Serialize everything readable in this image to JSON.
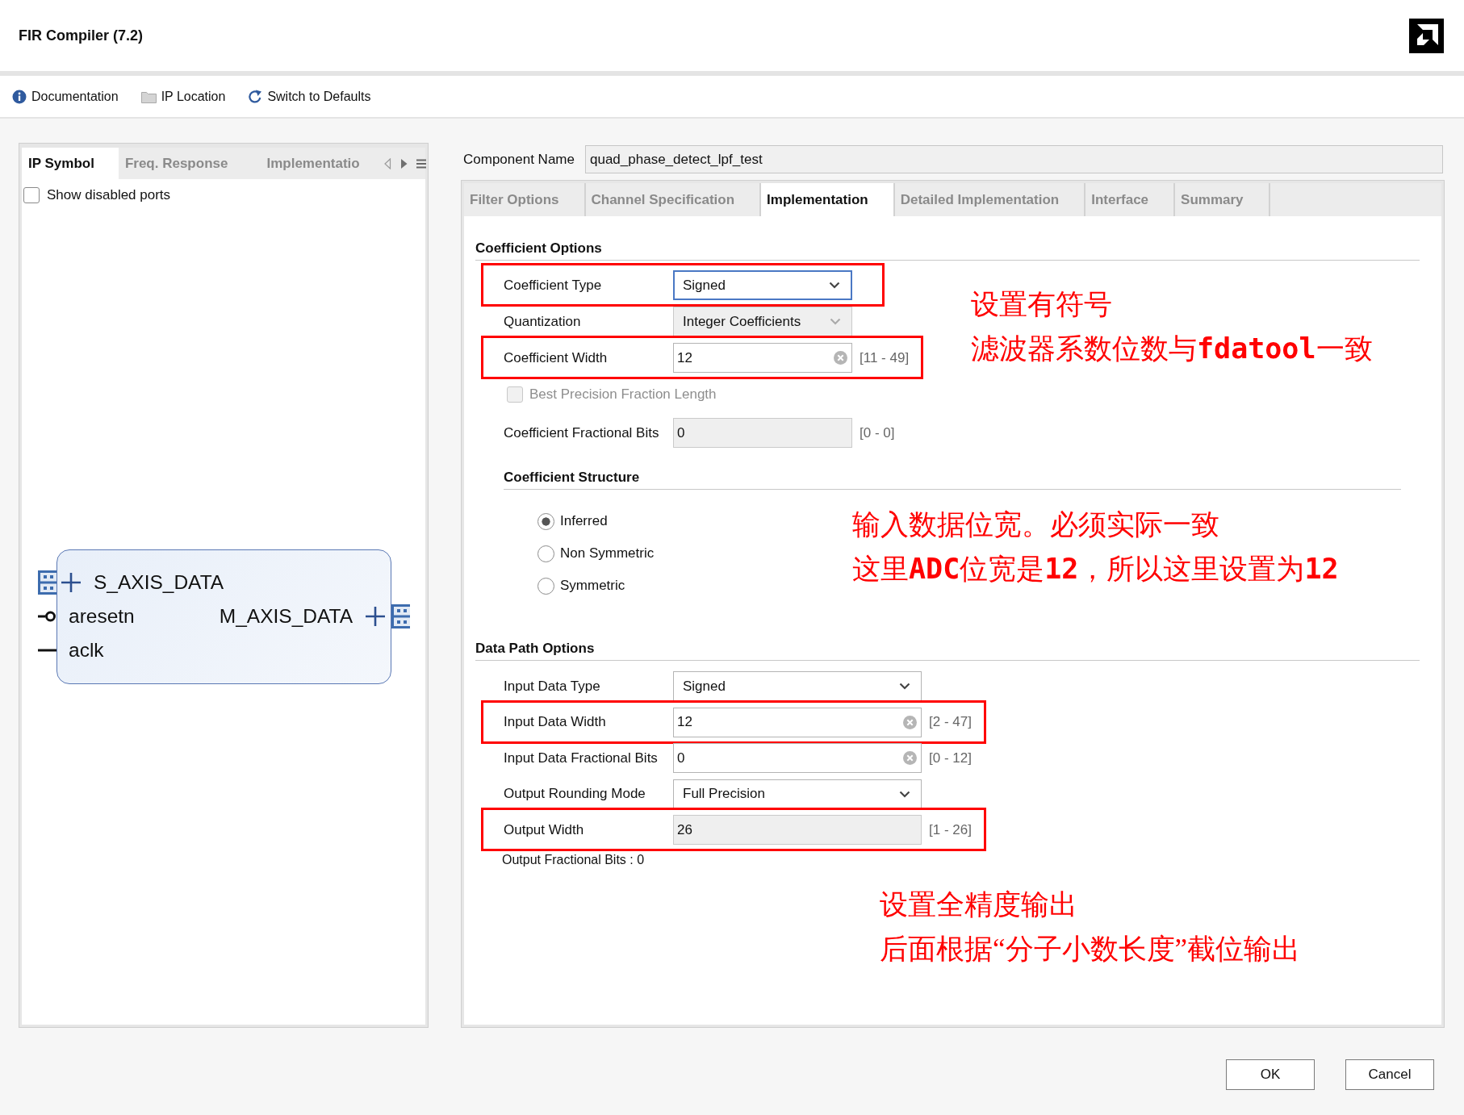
{
  "window": {
    "title": "FIR Compiler (7.2)"
  },
  "toolbar": [
    {
      "kind": "info",
      "label": "Documentation"
    },
    {
      "kind": "folder",
      "label": "IP Location"
    },
    {
      "kind": "reset",
      "label": "Switch to Defaults"
    }
  ],
  "left_panel": {
    "tabs": [
      {
        "label": "IP Symbol",
        "selected": true
      },
      {
        "label": "Freq. Response",
        "selected": false
      },
      {
        "label": "Implementatio",
        "selected": false
      }
    ],
    "show_disabled_ports": {
      "label": "Show disabled ports",
      "checked": false
    },
    "ip_symbol": {
      "rows": [
        {
          "left": {
            "name": "S_AXIS_DATA",
            "kind": "bus"
          }
        },
        {
          "left": {
            "name": "aresetn",
            "kind": "reset"
          },
          "right": {
            "name": "M_AXIS_DATA",
            "kind": "bus"
          }
        },
        {
          "left": {
            "name": "aclk",
            "kind": "clock"
          }
        }
      ]
    }
  },
  "component_name": {
    "label": "Component Name",
    "value": "quad_phase_detect_lpf_test"
  },
  "tabs": [
    {
      "label": "Filter Options",
      "selected": false
    },
    {
      "label": "Channel Specification",
      "selected": false
    },
    {
      "label": "Implementation",
      "selected": true
    },
    {
      "label": "Detailed Implementation",
      "selected": false
    },
    {
      "label": "Interface",
      "selected": false
    },
    {
      "label": "Summary",
      "selected": false
    }
  ],
  "coefficient_options": {
    "title": "Coefficient Options",
    "rows": [
      {
        "kind": "dropdown",
        "label": "Coefficient Type",
        "value": "Signed",
        "disabled": false,
        "focused": true,
        "highlighted": true
      },
      {
        "kind": "dropdown",
        "label": "Quantization",
        "value": "Integer Coefficients",
        "disabled": true,
        "focused": false,
        "highlighted": false
      },
      {
        "kind": "text",
        "label": "Coefficient Width",
        "value": "12",
        "range": "[11 - 49]",
        "disabled": false,
        "focused": false,
        "highlighted": true
      },
      {
        "kind": "checkbox",
        "label": "Best Precision Fraction Length",
        "checked": false,
        "disabled": true,
        "focused": false,
        "highlighted": false
      },
      {
        "kind": "text",
        "label": "Coefficient Fractional Bits",
        "value": "0",
        "range": "[0 - 0]",
        "disabled": true,
        "focused": false,
        "highlighted": false
      }
    ]
  },
  "coefficient_structure": {
    "title": "Coefficient Structure",
    "options": [
      {
        "label": "Inferred",
        "selected": true
      },
      {
        "label": "Non Symmetric",
        "selected": false
      },
      {
        "label": "Symmetric",
        "selected": false
      }
    ]
  },
  "data_path_options": {
    "title": "Data Path Options",
    "rows": [
      {
        "kind": "dropdown",
        "label": "Input Data Type",
        "value": "Signed",
        "disabled": false,
        "focused": false,
        "highlighted": false
      },
      {
        "kind": "text",
        "label": "Input Data Width",
        "value": "12",
        "range": "[2 - 47]",
        "disabled": false,
        "focused": false,
        "highlighted": true
      },
      {
        "kind": "text",
        "label": "Input Data Fractional Bits",
        "value": "0",
        "range": "[0 - 12]",
        "disabled": false,
        "focused": false,
        "highlighted": false
      },
      {
        "kind": "dropdown",
        "label": "Output Rounding Mode",
        "value": "Full Precision",
        "disabled": false,
        "focused": false,
        "highlighted": false
      },
      {
        "kind": "text",
        "label": "Output Width",
        "value": "26",
        "range": "[1 - 26]",
        "disabled": true,
        "focused": false,
        "highlighted": true
      }
    ],
    "note": "Output Fractional Bits : 0"
  },
  "annotations": [
    {
      "lines": [
        "设置有符号",
        "滤波器系数位数与**fdatool**一致"
      ]
    },
    {
      "lines": [
        "输入数据位宽。必须实际一致",
        "这里**ADC**位宽是**12**，所以这里设置为**12**"
      ]
    },
    {
      "lines": [
        "设置全精度输出",
        "后面根据“分子小数长度”截位输出"
      ]
    }
  ],
  "buttons": [
    "OK",
    "Cancel"
  ]
}
